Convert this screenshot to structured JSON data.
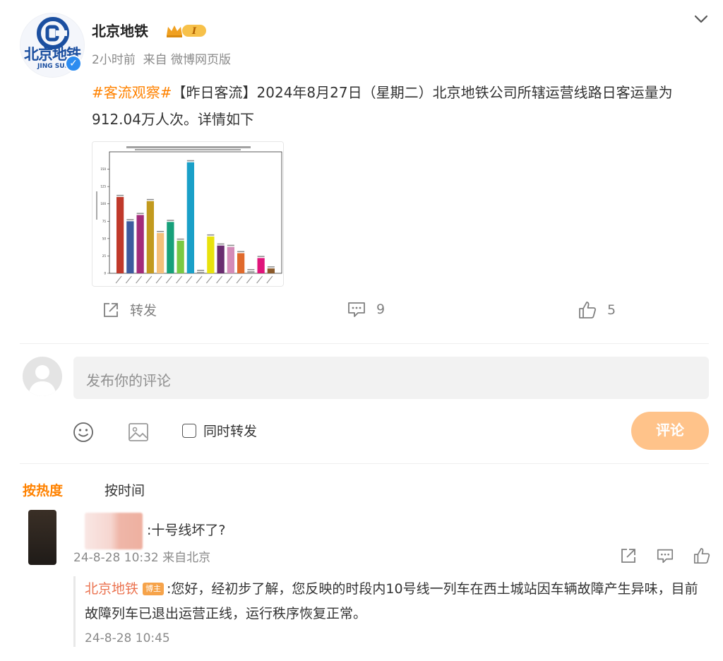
{
  "post": {
    "user_name": "北京地铁",
    "avatar_text": "北京地铁",
    "avatar_sub": "JING SUI",
    "badge_level": "I",
    "meta": "2小时前  来自 微博网页版",
    "topic": "#客流观察#",
    "body": "【昨日客流】2024年8月27日（星期二）北京地铁公司所辖运营线路日客运量为912.04万人次。详情如下"
  },
  "actions": {
    "repost_label": "转发",
    "comment_count": "9",
    "like_count": "5"
  },
  "composer": {
    "placeholder": "发布你的评论",
    "repost_option": "同时转发",
    "submit_label": "评论"
  },
  "sort_tabs": {
    "hot": "按热度",
    "time": "按时间"
  },
  "comment": {
    "text": ":十号线坏了?",
    "meta": "24-8-28 10:32 来自北京",
    "reply": {
      "name": "北京地铁",
      "badge": "博主",
      "text": ":您好，经初步了解，您反映的时段内10号线一列车在西土城站因车辆故障产生异味，目前故障列车已退出运营正线，运行秩序恢复正常。",
      "time": "24-8-28 10:45"
    }
  },
  "colors": {
    "accent": "#ff8200",
    "reply_name": "#eb7350",
    "submit_bg": "#ffc38a"
  },
  "chart_data": {
    "type": "bar",
    "title": "",
    "xlabel": "",
    "ylabel": "",
    "ylim": [
      0,
      175
    ],
    "yticks": [
      0,
      25,
      50,
      75,
      100,
      125,
      150
    ],
    "values": [
      110,
      75,
      84,
      104,
      58,
      74,
      47,
      160,
      2,
      53,
      40,
      38,
      29,
      3,
      22,
      7
    ],
    "colors": [
      "#c0392b",
      "#3d5a9e",
      "#a32b7a",
      "#c29a1e",
      "#f5c07a",
      "#17a07a",
      "#7ac943",
      "#1aa0c8",
      "#999999",
      "#e8e20c",
      "#6a2c70",
      "#d48bb8",
      "#e06a2c",
      "#a0a0a0",
      "#e0157a",
      "#8b5a2b"
    ]
  }
}
